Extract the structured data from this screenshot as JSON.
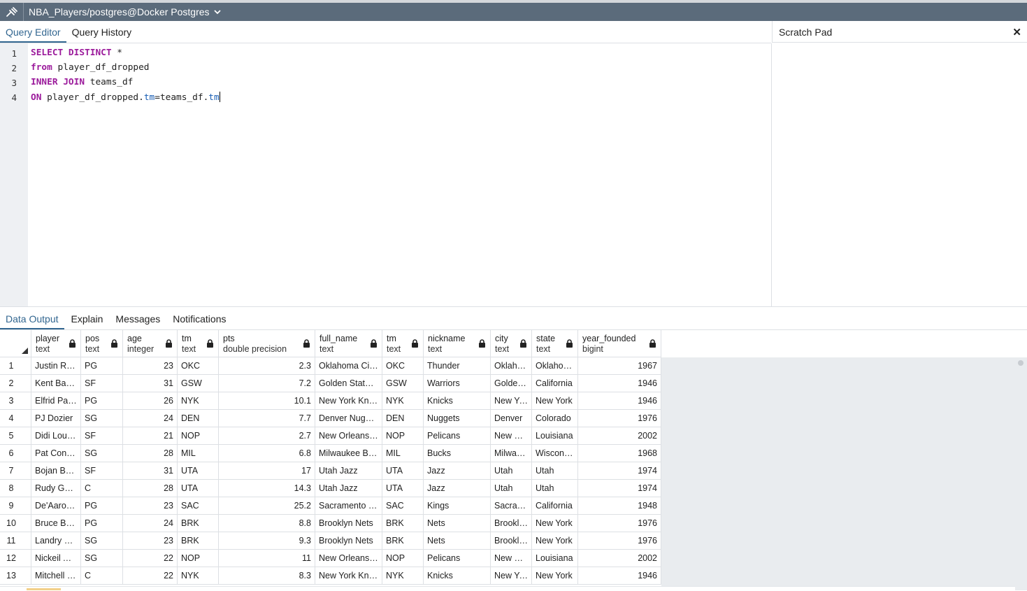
{
  "connection": {
    "label": "NBA_Players/postgres@Docker Postgres",
    "icon": "connection-plug-icon"
  },
  "editor_tabs": [
    {
      "label": "Query Editor",
      "active": true
    },
    {
      "label": "Query History",
      "active": false
    }
  ],
  "scratch_pad": {
    "title": "Scratch Pad",
    "close": "✕"
  },
  "editor": {
    "line_numbers": [
      "1",
      "2",
      "3",
      "4"
    ],
    "lines": [
      [
        {
          "t": "SELECT DISTINCT",
          "c": "kw"
        },
        {
          "t": " *",
          "c": ""
        }
      ],
      [
        {
          "t": "from",
          "c": "kw"
        },
        {
          "t": " player_df_dropped",
          "c": ""
        }
      ],
      [
        {
          "t": "INNER JOIN",
          "c": "kw"
        },
        {
          "t": " teams_df",
          "c": ""
        }
      ],
      [
        {
          "t": "ON",
          "c": "kw"
        },
        {
          "t": " player_df_dropped.",
          "c": ""
        },
        {
          "t": "tm",
          "c": "fld"
        },
        {
          "t": "=teams_df.",
          "c": ""
        },
        {
          "t": "tm",
          "c": "fld"
        }
      ]
    ]
  },
  "result_tabs": [
    {
      "label": "Data Output",
      "active": true
    },
    {
      "label": "Explain",
      "active": false
    },
    {
      "label": "Messages",
      "active": false
    },
    {
      "label": "Notifications",
      "active": false
    }
  ],
  "columns": [
    {
      "name": "player",
      "type": "text"
    },
    {
      "name": "pos",
      "type": "text"
    },
    {
      "name": "age",
      "type": "integer"
    },
    {
      "name": "tm",
      "type": "text"
    },
    {
      "name": "pts",
      "type": "double precision"
    },
    {
      "name": "full_name",
      "type": "text"
    },
    {
      "name": "tm",
      "type": "text"
    },
    {
      "name": "nickname",
      "type": "text"
    },
    {
      "name": "city",
      "type": "text"
    },
    {
      "name": "state",
      "type": "text"
    },
    {
      "name": "year_founded",
      "type": "bigint"
    }
  ],
  "rows": [
    [
      "1",
      "Justin Ro...",
      "PG",
      "23",
      "OKC",
      "2.3",
      "Oklahoma City...",
      "OKC",
      "Thunder",
      "Oklaho...",
      "Oklahoma",
      "1967"
    ],
    [
      "2",
      "Kent Baze...",
      "SF",
      "31",
      "GSW",
      "7.2",
      "Golden State ...",
      "GSW",
      "Warriors",
      "Golden ...",
      "California",
      "1946"
    ],
    [
      "3",
      "Elfrid Pay...",
      "PG",
      "26",
      "NYK",
      "10.1",
      "New York Knic...",
      "NYK",
      "Knicks",
      "New Yo...",
      "New York",
      "1946"
    ],
    [
      "4",
      "PJ Dozier",
      "SG",
      "24",
      "DEN",
      "7.7",
      "Denver Nuggets",
      "DEN",
      "Nuggets",
      "Denver",
      "Colorado",
      "1976"
    ],
    [
      "5",
      "Didi Louz...",
      "SF",
      "21",
      "NOP",
      "2.7",
      "New Orleans ...",
      "NOP",
      "Pelicans",
      "New Or...",
      "Louisiana",
      "2002"
    ],
    [
      "6",
      "Pat Conn...",
      "SG",
      "28",
      "MIL",
      "6.8",
      "Milwaukee Bu...",
      "MIL",
      "Bucks",
      "Milwau...",
      "Wisconsin",
      "1968"
    ],
    [
      "7",
      "Bojan Bo...",
      "SF",
      "31",
      "UTA",
      "17",
      "Utah Jazz",
      "UTA",
      "Jazz",
      "Utah",
      "Utah",
      "1974"
    ],
    [
      "8",
      "Rudy Gob...",
      "C",
      "28",
      "UTA",
      "14.3",
      "Utah Jazz",
      "UTA",
      "Jazz",
      "Utah",
      "Utah",
      "1974"
    ],
    [
      "9",
      "De'Aaron ...",
      "PG",
      "23",
      "SAC",
      "25.2",
      "Sacramento Ki...",
      "SAC",
      "Kings",
      "Sacram...",
      "California",
      "1948"
    ],
    [
      "10",
      "Bruce Bro...",
      "PG",
      "24",
      "BRK",
      "8.8",
      "Brooklyn Nets",
      "BRK",
      "Nets",
      "Brooklyn",
      "New York",
      "1976"
    ],
    [
      "11",
      "Landry Sh...",
      "SG",
      "23",
      "BRK",
      "9.3",
      "Brooklyn Nets",
      "BRK",
      "Nets",
      "Brooklyn",
      "New York",
      "1976"
    ],
    [
      "12",
      "Nickeil Al...",
      "SG",
      "22",
      "NOP",
      "11",
      "New Orleans ...",
      "NOP",
      "Pelicans",
      "New Or...",
      "Louisiana",
      "2002"
    ],
    [
      "13",
      "Mitchell R...",
      "C",
      "22",
      "NYK",
      "8.3",
      "New York Knic...",
      "NYK",
      "Knicks",
      "New Yo...",
      "New York",
      "1946"
    ]
  ]
}
